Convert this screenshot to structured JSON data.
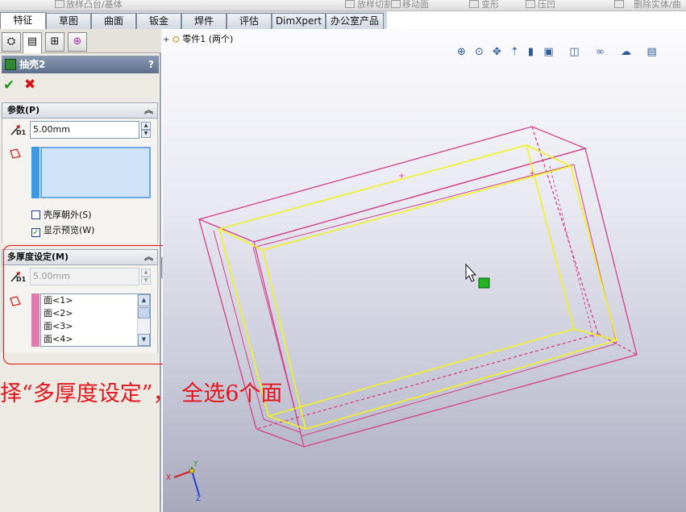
{
  "ribbon": {
    "items": [
      "放样凸台/基体",
      "放样切割",
      "移动面",
      "变形",
      "压凹",
      "删除实体/曲"
    ]
  },
  "tabs": [
    "特征",
    "草图",
    "曲面",
    "钣金",
    "焊件",
    "评估",
    "DimXpert",
    "办公室产品"
  ],
  "active_tab": "特征",
  "property_manager": {
    "title": "抽壳2",
    "help": "?",
    "ok": "✔",
    "cancel": "✖",
    "parameters": {
      "header": "参数(P)",
      "thickness_value": "5.00mm",
      "thickness_icon_label": "D1",
      "shell_outward_label": "壳厚朝外(S)",
      "shell_outward_checked": false,
      "show_preview_label": "显示预览(W)",
      "show_preview_checked": true
    },
    "multi_thickness": {
      "header": "多厚度设定(M)",
      "thickness_value": "5.00mm",
      "thickness_icon_label": "D1",
      "faces": [
        "面<1>",
        "面<2>",
        "面<3>",
        "面<4>"
      ]
    }
  },
  "viewport": {
    "tree_label": "零件1  (两个)",
    "instruction": "择“多厚度设定”， 全选6个面",
    "triad": {
      "x": "X",
      "y": "Y",
      "z": "Z"
    }
  },
  "colors": {
    "pm_title_bg": "#5d6f8d",
    "outer_edges": "#d4408a",
    "inner_edges": "#f2f21e",
    "selection_box": "#cfe4f8",
    "callout_red": "#e4141c",
    "selected_face_marker": "#22b422"
  }
}
